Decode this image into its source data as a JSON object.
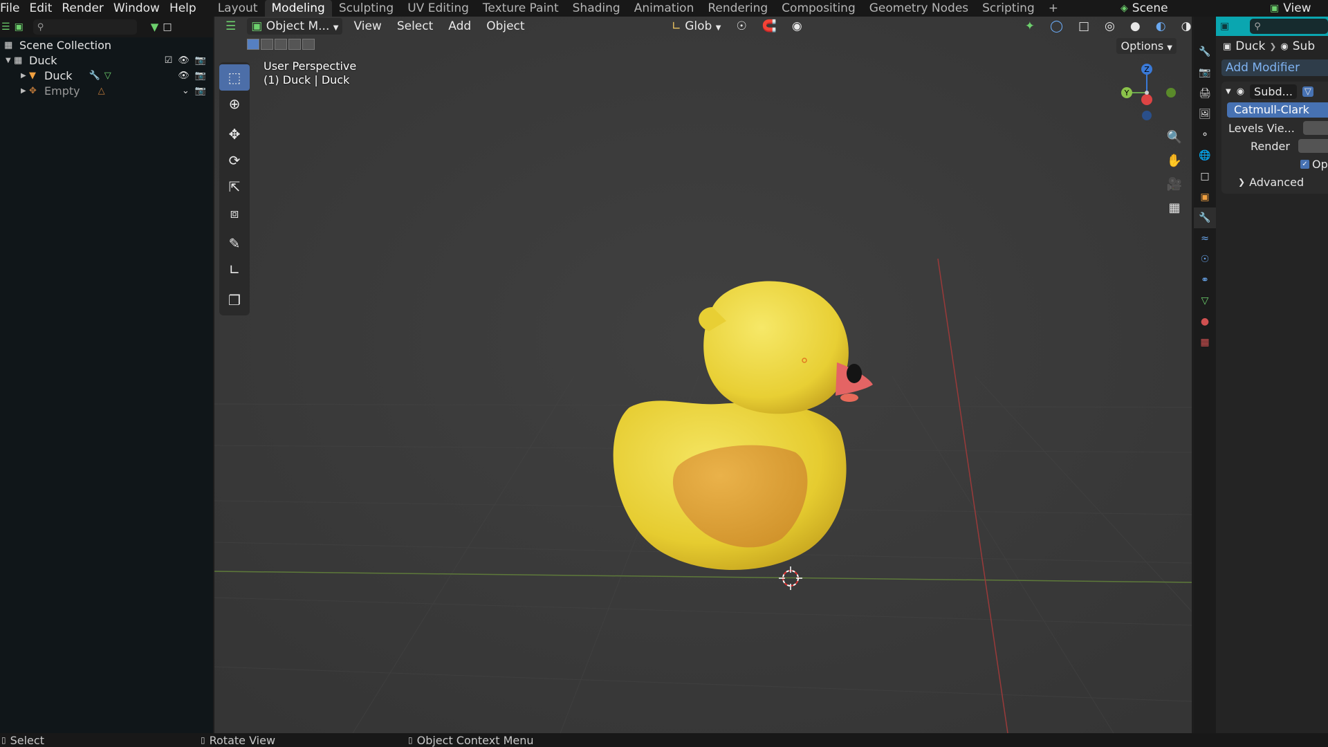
{
  "topbar": {
    "menus": [
      "File",
      "Edit",
      "Render",
      "Window",
      "Help"
    ],
    "workspace_tabs": [
      "Layout",
      "Modeling",
      "Sculpting",
      "UV Editing",
      "Texture Paint",
      "Shading",
      "Animation",
      "Rendering",
      "Compositing",
      "Geometry Nodes",
      "Scripting",
      "+"
    ],
    "active_tab": "Modeling",
    "scene_label": "Scene",
    "view_label": "View"
  },
  "outliner": {
    "search_placeholder": "",
    "collection": "Scene Collection",
    "items": [
      {
        "label": "Duck",
        "type": "collection"
      },
      {
        "label": "Duck",
        "type": "mesh"
      },
      {
        "label": "Empty",
        "type": "empty"
      }
    ]
  },
  "viewport": {
    "mode": "Object M...",
    "menus": [
      "View",
      "Select",
      "Add",
      "Object"
    ],
    "orientation": "Glob",
    "options": "Options",
    "perspective": "User Perspective",
    "object_info": "(1) Duck  | Duck",
    "axis_labels": {
      "z": "Z",
      "y": "Y"
    }
  },
  "properties": {
    "breadcrumb_object": "Duck",
    "breadcrumb_modifier": "Sub",
    "add_modifier": "Add Modifier",
    "modifier_name": "Subd...",
    "algorithm": "Catmull-Clark",
    "levels_label": "Levels Vie...",
    "render_label": "Render",
    "optimal_label": "Opt",
    "advanced_label": "Advanced"
  },
  "statusbar": {
    "left": "Select",
    "middle": "Rotate View",
    "right": "Object Context Menu"
  },
  "colors": {
    "accent": "#4772b3",
    "props_header": "#0aa6b0",
    "duck_body": "#ecd43a",
    "duck_wing": "#e0a33a",
    "duck_beak": "#e06262"
  }
}
